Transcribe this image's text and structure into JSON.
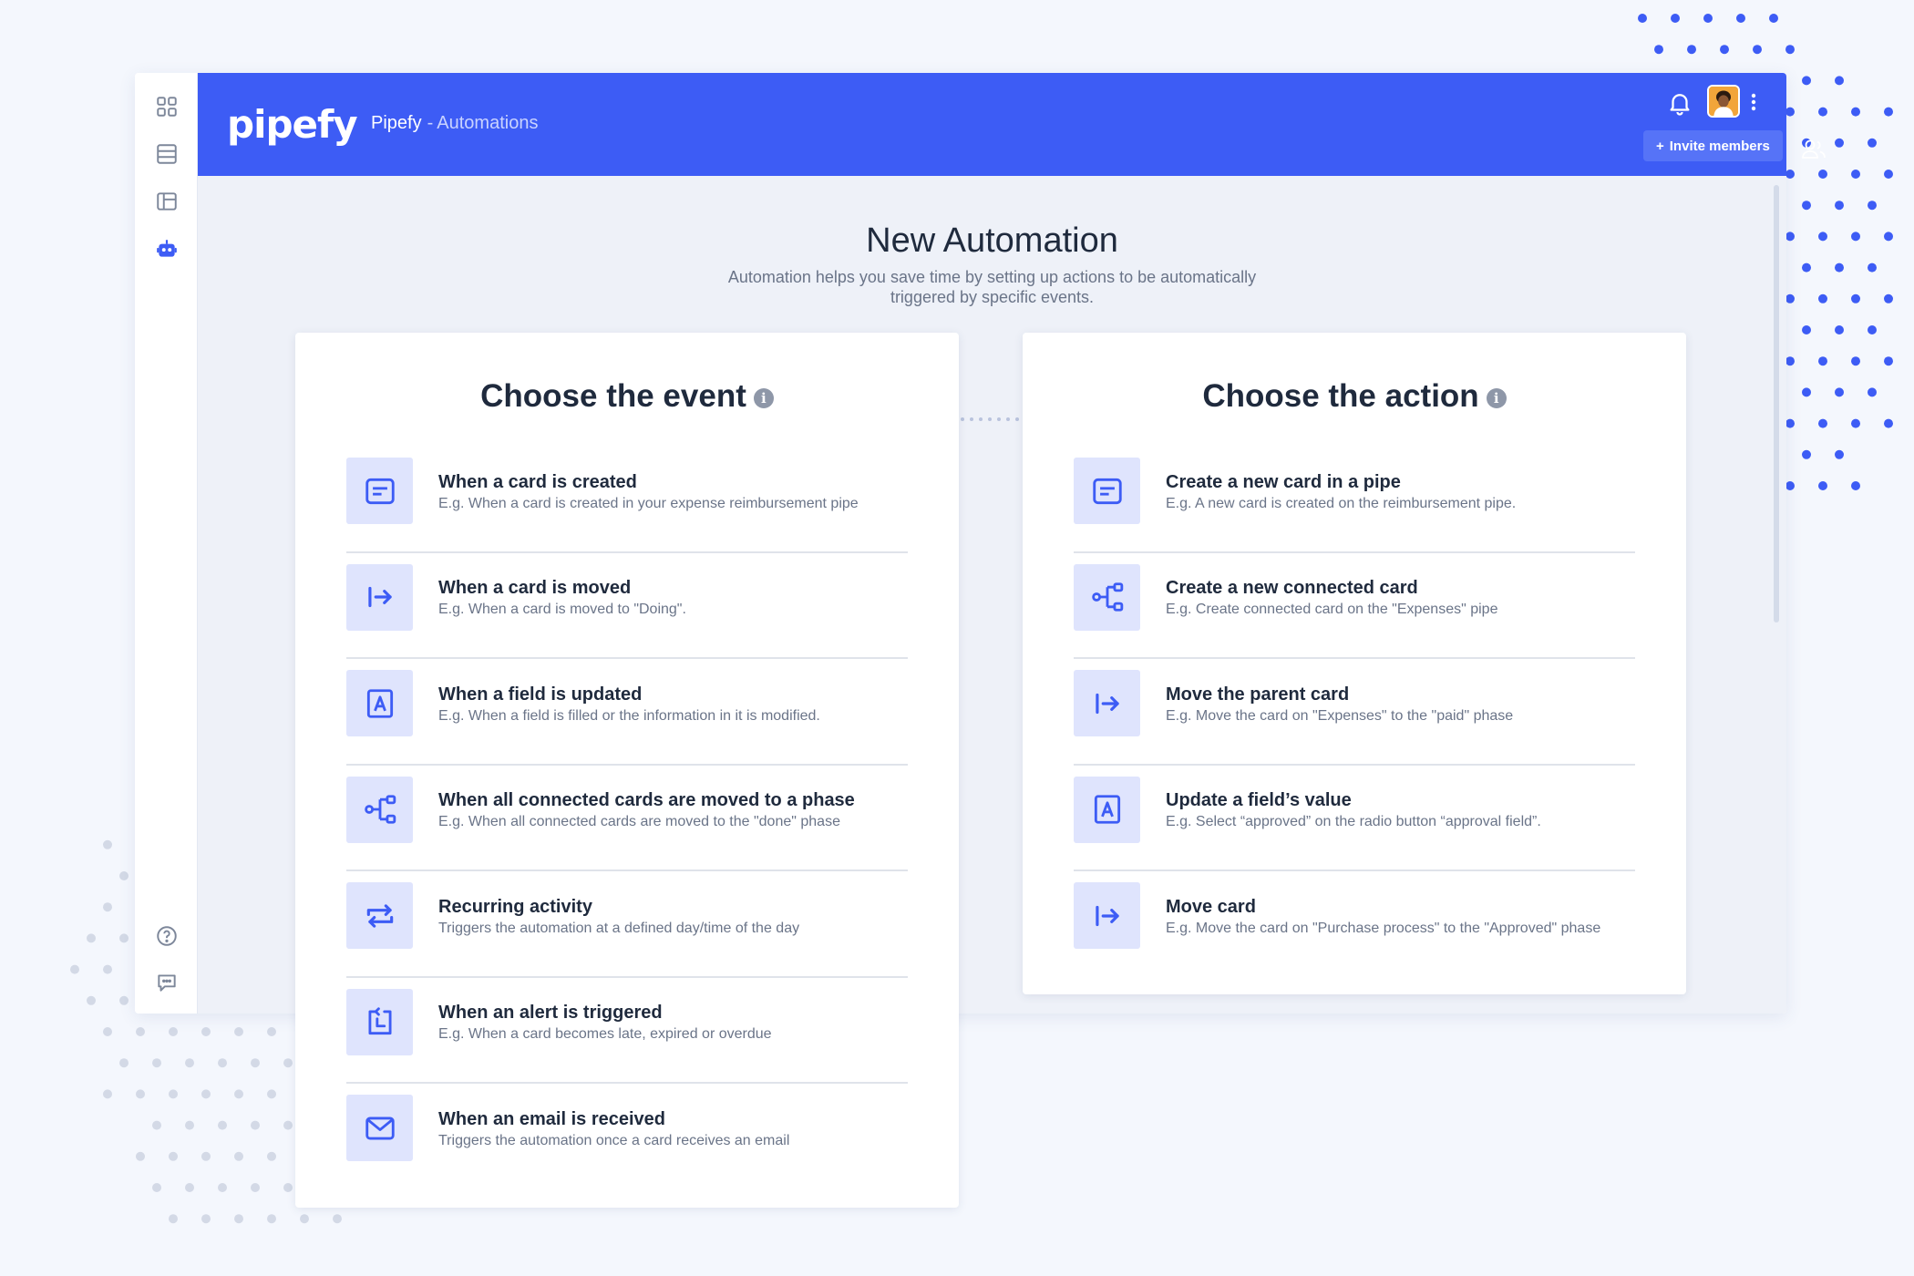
{
  "app": {
    "logo": "pipefy",
    "breadcrumb_org": "Pipefy",
    "breadcrumb_sep": "-",
    "breadcrumb_page": "Automations"
  },
  "header": {
    "invite_label": "Invite members"
  },
  "colors": {
    "brand": "#3d5cf5",
    "tile": "#dfe4fd",
    "icon": "#3d5cf5"
  },
  "page": {
    "title": "New Automation",
    "subtitle": "Automation helps you save time by setting up actions to be automatically triggered by specific events."
  },
  "event_panel": {
    "title": "Choose the event",
    "info_icon": "i",
    "items": [
      {
        "icon": "card-icon",
        "title": "When a card is created",
        "desc": "E.g. When a card is created in your expense reimbursement pipe"
      },
      {
        "icon": "move-icon",
        "title": "When a card is moved",
        "desc": "E.g. When a card is moved to \"Doing\"."
      },
      {
        "icon": "field-icon",
        "title": "When a field is updated",
        "desc": "E.g. When a field is filled or the information in it is modified."
      },
      {
        "icon": "connected-icon",
        "title": "When all connected cards are moved to a phase",
        "desc": "E.g. When all connected cards are moved to the \"done\" phase"
      },
      {
        "icon": "recurring-icon",
        "title": "Recurring activity",
        "desc": "Triggers the automation at a defined day/time of the day"
      },
      {
        "icon": "alert-icon",
        "title": "When an alert is triggered",
        "desc": "E.g. When a card becomes late, expired or overdue"
      },
      {
        "icon": "email-icon",
        "title": "When an email is received",
        "desc": "Triggers the automation once a card receives an email"
      }
    ]
  },
  "action_panel": {
    "title": "Choose the action",
    "info_icon": "i",
    "items": [
      {
        "icon": "card-icon",
        "title": "Create a new card in a pipe",
        "desc": "E.g. A new card is created on the reimbursement pipe."
      },
      {
        "icon": "connected-icon",
        "title": "Create a new connected card",
        "desc": "E.g. Create connected card on the \"Expenses\" pipe"
      },
      {
        "icon": "move-icon",
        "title": "Move the parent card",
        "desc": "E.g. Move the card on \"Expenses\" to the \"paid\" phase"
      },
      {
        "icon": "field-icon",
        "title": "Update a field’s value",
        "desc": "E.g. Select “approved” on the radio button “approval field”."
      },
      {
        "icon": "move-icon",
        "title": "Move card",
        "desc": "E.g. Move the card on \"Purchase process\" to the \"Approved\" phase"
      }
    ]
  }
}
